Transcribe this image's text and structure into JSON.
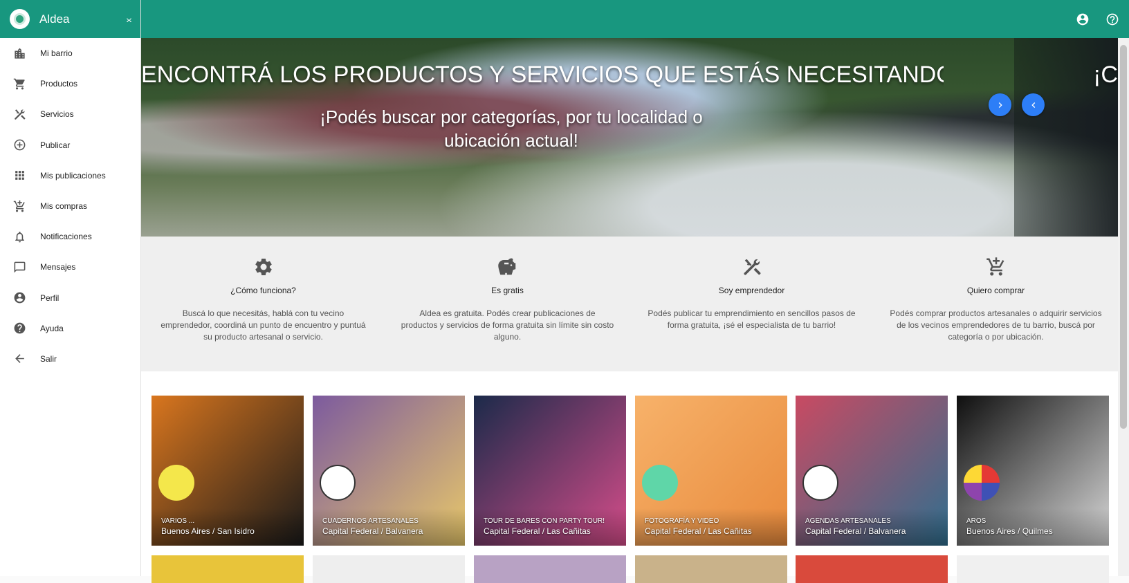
{
  "app": {
    "title": "Aldea"
  },
  "sidebar": {
    "collapse_label": "›‹",
    "items": [
      {
        "label": "Mi barrio",
        "icon": "city-icon"
      },
      {
        "label": "Productos",
        "icon": "cart-icon"
      },
      {
        "label": "Servicios",
        "icon": "tools-icon"
      },
      {
        "label": "Publicar",
        "icon": "add-circle-icon"
      },
      {
        "label": "Mis publicaciones",
        "icon": "apps-grid-icon"
      },
      {
        "label": "Mis compras",
        "icon": "cart-plus-icon"
      },
      {
        "label": "Notificaciones",
        "icon": "bell-icon"
      },
      {
        "label": "Mensajes",
        "icon": "message-icon"
      },
      {
        "label": "Perfil",
        "icon": "account-circle-icon"
      },
      {
        "label": "Ayuda",
        "icon": "help-circle-icon"
      },
      {
        "label": "Salir",
        "icon": "arrow-left-icon"
      }
    ]
  },
  "topbar": {
    "icons": [
      "account-circle-icon",
      "help-outline-icon"
    ]
  },
  "hero": {
    "title": "ENCONTRÁ LOS PRODUCTOS Y SERVICIOS QUE ESTÁS NECESITANDO",
    "title_next": "¡C",
    "subtitle": "¡Podés buscar por categorías, por tu localidad o ubicación actual!"
  },
  "features": [
    {
      "icon": "gear-icon",
      "title": "¿Cómo funciona?",
      "text": "Buscá lo que necesitás, hablá con tu vecino emprendedor, coordiná un punto de encuentro y puntuá su producto artesanal o servicio."
    },
    {
      "icon": "piggy-bank-icon",
      "title": "Es gratis",
      "text": "Aldea es gratuita. Podés crear publicaciones de productos y servicios de forma gratuita sin límite sin costo alguno."
    },
    {
      "icon": "tools-icon",
      "title": "Soy emprendedor",
      "text": "Podés publicar tu emprendimiento en sencillos pasos de forma gratuita, ¡sé el especialista de tu barrio!"
    },
    {
      "icon": "cart-plus-icon",
      "title": "Quiero comprar",
      "text": "Podés comprar productos artesanales o adquirir servicios de los vecinos emprendedores de tu barrio, buscá por categoría o por ubicación."
    }
  ],
  "cards": [
    {
      "category": "VARIOS ...",
      "location": "Buenos Aires / San Isidro",
      "colors": [
        "#d9761e",
        "#1a1a1a"
      ]
    },
    {
      "category": "CUADERNOS ARTESANALES",
      "location": "Capital Federal / Balvanera",
      "colors": [
        "#7c5a9e",
        "#e8c86a"
      ]
    },
    {
      "category": "TOUR DE BARES CON PARTY TOUR!",
      "location": "Capital Federal / Las Cañitas",
      "colors": [
        "#1b2a4a",
        "#d64d8a"
      ]
    },
    {
      "category": "FOTOGRAFÍA Y VIDEO",
      "location": "Capital Federal / Las Cañitas",
      "colors": [
        "#f7b26a",
        "#e88a3c"
      ]
    },
    {
      "category": "AGENDAS ARTESANALES",
      "location": "Capital Federal / Balvanera",
      "colors": [
        "#c94a62",
        "#2f6f8f"
      ]
    },
    {
      "category": "AROS",
      "location": "Buenos Aires / Quilmes",
      "colors": [
        "#0f0f0f",
        "#d8d8d8"
      ]
    }
  ]
}
